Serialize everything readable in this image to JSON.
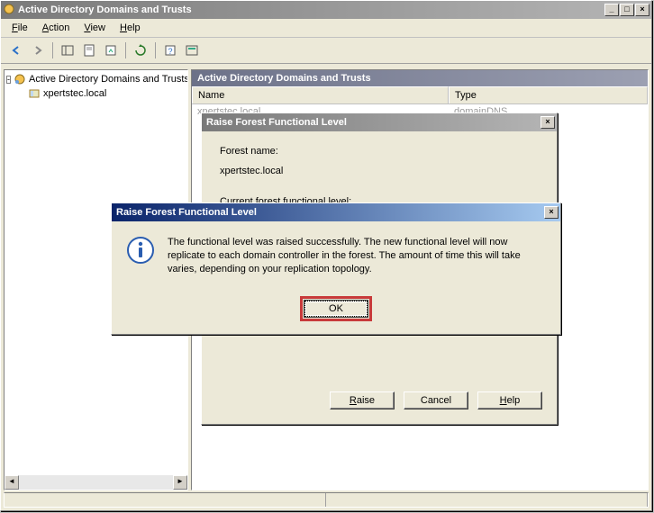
{
  "main_window": {
    "title": "Active Directory Domains and Trusts",
    "menu": {
      "file": "File",
      "action": "Action",
      "view": "View",
      "help": "Help"
    },
    "tree": {
      "root": "Active Directory Domains and Trusts",
      "child": "xpertstec.local"
    },
    "list": {
      "header": "Active Directory Domains and Trusts",
      "col_name": "Name",
      "col_type": "Type",
      "row_name": "xpertstec.local",
      "row_type": "domainDNS"
    }
  },
  "dialog1": {
    "title": "Raise Forest Functional Level",
    "label_forest_name": "Forest name:",
    "forest_name": "xpertstec.local",
    "label_current": "Current forest functional level:",
    "btn_raise": "Raise",
    "btn_cancel": "Cancel",
    "btn_help": "Help"
  },
  "msgbox": {
    "title": "Raise Forest Functional Level",
    "text": "The functional level was raised successfully. The new functional level will now replicate to each domain controller in the forest. The amount of time this will take varies, depending on your replication topology.",
    "btn_ok": "OK"
  }
}
